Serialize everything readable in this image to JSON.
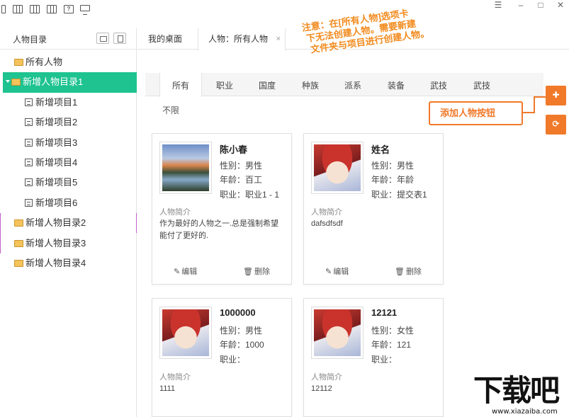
{
  "window": {
    "toolbar_icons": [
      "single-pane-icon",
      "two-pane-icon",
      "three-pane-icon",
      "four-pane-icon",
      "help-icon",
      "monitor-icon"
    ],
    "help_glyph": "?",
    "menu_glyph": "☰",
    "minimize_glyph": "–",
    "maximize_glyph": "□",
    "close_glyph": "✕"
  },
  "sidebar": {
    "title": "人物目录",
    "items": [
      {
        "label": "所有人物",
        "type": "folder",
        "level": 0
      },
      {
        "label": "新增人物目录1",
        "type": "folder",
        "level": 0,
        "active": true,
        "expanded": true
      },
      {
        "label": "新增项目1",
        "type": "doc",
        "level": 1
      },
      {
        "label": "新增项目2",
        "type": "doc",
        "level": 1
      },
      {
        "label": "新增项目3",
        "type": "doc",
        "level": 1
      },
      {
        "label": "新增项目4",
        "type": "doc",
        "level": 1
      },
      {
        "label": "新增项目5",
        "type": "doc",
        "level": 1
      },
      {
        "label": "新增项目6",
        "type": "doc",
        "level": 1
      },
      {
        "label": "新增人物目录2",
        "type": "folder",
        "level": 0
      },
      {
        "label": "新增人物目录3",
        "type": "folder",
        "level": 0
      },
      {
        "label": "新增人物目录4",
        "type": "folder",
        "level": 0
      }
    ]
  },
  "tabs": {
    "desk": "我的桌面",
    "current": "人物：所有人物",
    "close_glyph": "×"
  },
  "annotation": {
    "line1": "注意：在[所有人物]选项卡",
    "line2": "下无法创建人物。需要新建",
    "line3": "文件夹与项目进行创建人物。",
    "button_callout": "添加人物按钮"
  },
  "filter": {
    "tabs": [
      "所有",
      "职业",
      "国度",
      "种族",
      "派系",
      "装备",
      "武技",
      "武技"
    ],
    "value": "不限"
  },
  "actions": {
    "add_glyph": "✚",
    "refresh_glyph": "⟳"
  },
  "cards": [
    {
      "name": "陈小春",
      "gender": "性别：男性",
      "age": "年龄：百工",
      "job": "职业：职业1 - 1",
      "intro_label": "人物简介",
      "intro": "作为最好的人物之一.总是强制希望能付了更好的.",
      "edit": "编辑",
      "delete": "删除",
      "photo": "landscape"
    },
    {
      "name": "姓名",
      "gender": "性别：男性",
      "age": "年龄：年龄",
      "job": "职业：提交表1",
      "intro_label": "人物简介",
      "intro": "dafsdfsdf",
      "edit": "编辑",
      "delete": "删除",
      "photo": "anime"
    },
    {
      "name": "1000000",
      "gender": "性别：男性",
      "age": "年龄：1000",
      "job": "职业：",
      "intro_label": "人物简介",
      "intro": "1111",
      "edit": "编辑",
      "delete": "删除",
      "photo": "anime"
    },
    {
      "name": "12121",
      "gender": "性别：女性",
      "age": "年龄：121",
      "job": "职业：",
      "intro_label": "人物简介",
      "intro": "12112",
      "edit": "编辑",
      "delete": "删除",
      "photo": "anime"
    }
  ],
  "watermark": {
    "big": "下载吧",
    "small": "www.xiazaiba.com"
  },
  "colors": {
    "accent_green": "#1ec38f",
    "accent_orange": "#f0792a"
  }
}
